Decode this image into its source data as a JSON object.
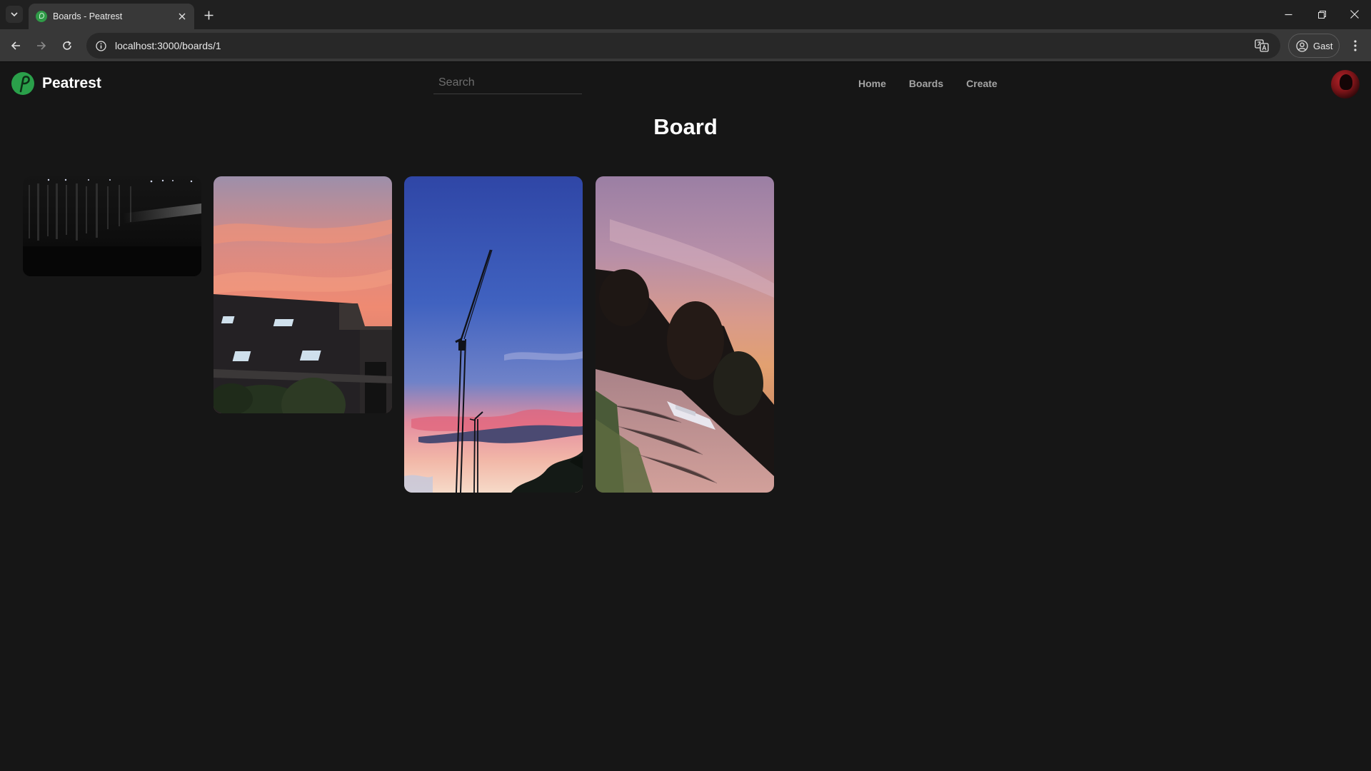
{
  "browser": {
    "tab_title": "Boards - Peatrest",
    "url": "localhost:3000/boards/1",
    "profile_label": "Gast"
  },
  "app": {
    "brand": "Peatrest",
    "search_placeholder": "Search",
    "nav": [
      "Home",
      "Boards",
      "Create"
    ]
  },
  "board": {
    "title": "Board",
    "pins": [
      {
        "name": "pin-dark-curtain",
        "scene": "dark curtain with light beam"
      },
      {
        "name": "pin-sunset-rooftop",
        "scene": "sunset over rooftop"
      },
      {
        "name": "pin-crane-sky",
        "scene": "crane against evening sky"
      },
      {
        "name": "pin-canal-boat",
        "scene": "boat on canal at sunset"
      }
    ]
  },
  "colors": {
    "background": "#161616",
    "brand_green": "#2aa04a",
    "nav_link": "#a4a4a4"
  }
}
